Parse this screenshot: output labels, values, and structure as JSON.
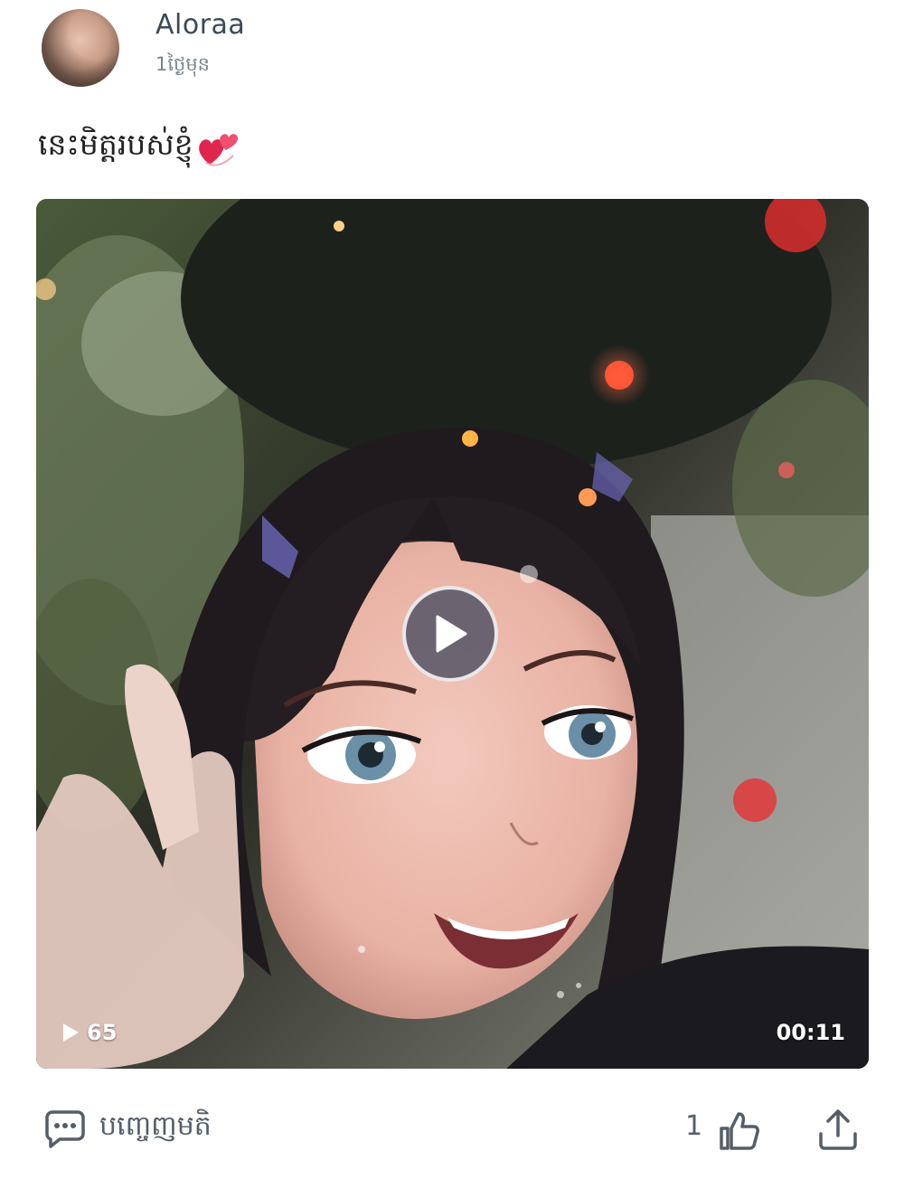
{
  "post": {
    "author": "Aloraa",
    "time_ago": "1ថ្ងៃមុន",
    "caption": "នេះមិត្តរបស់ខ្ញុំ"
  },
  "video": {
    "view_count": "65",
    "duration": "00:11"
  },
  "actions": {
    "comment_label": "បញ្ចេញមតិ",
    "like_count": "1"
  },
  "icons": {
    "caption_emoji": "two-hearts-icon",
    "views": "play-icon",
    "center": "play-button-icon",
    "comment": "comment-icon",
    "like": "thumbs-up-icon",
    "share": "share-icon"
  },
  "colors": {
    "heart": "#e0264f",
    "icon_gray": "#555e68"
  }
}
